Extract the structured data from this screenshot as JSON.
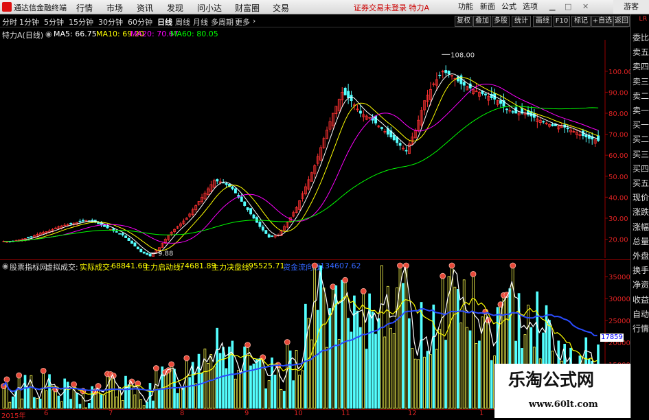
{
  "app": {
    "title": "通达信金融终端",
    "menu": [
      "行情",
      "市场",
      "资讯",
      "发现",
      "问小达",
      "财富圈",
      "交易"
    ],
    "notice": "证券交易未登录 特力A",
    "toolbar": [
      "功能",
      "新面",
      "公式",
      "选项"
    ],
    "guest": "游客"
  },
  "periods": {
    "items": [
      "分时",
      "1分钟",
      "5分钟",
      "15分钟",
      "30分钟",
      "60分钟",
      "日线",
      "周线",
      "月线",
      "多周期",
      "更多"
    ],
    "active": "日线"
  },
  "chart_tools": [
    "复权",
    "叠加",
    "多股",
    "统计",
    "画线",
    "F10",
    "标记",
    "+自选",
    "返回"
  ],
  "sidebar": {
    "items": [
      "委比",
      "卖五",
      "卖四",
      "卖三",
      "卖二",
      "卖一",
      "买一",
      "买二",
      "买三",
      "买四",
      "买五",
      "现价",
      "涨跌",
      "涨幅",
      "总量",
      "外盘",
      "换手",
      "净资",
      "收益",
      "自动",
      "行情"
    ],
    "extra": [
      "L",
      "R"
    ]
  },
  "price_info": {
    "stock": "特力A(日线)",
    "ma5": "MA5: 66.75",
    "ma10": "MA10: 69.20",
    "ma20": "MA20: 70.67",
    "ma60": "MA60: 80.05"
  },
  "vol_info": {
    "indicator": "股票指标网",
    "virtual": "虚拟成交:",
    "real": "实际成交:",
    "real_val": "68841.60",
    "start": "主力启动线:",
    "start_val": "74681.89",
    "decide": "主力决盘线:",
    "decide_val": "95525.71",
    "fund": "资金流向线:",
    "fund_val": "134607.62"
  },
  "annotations": {
    "high": "108.00",
    "low": "9.88"
  },
  "last_vol_label": "17859",
  "date_axis": [
    "2015年",
    "6",
    "7",
    "8",
    "9",
    "10",
    "11",
    "12",
    "1"
  ],
  "watermark": {
    "cn": "乐淘公式网",
    "url": "www.60lt.com"
  },
  "colors": {
    "up": "#ff3232",
    "down": "#54ffff",
    "ma5": "#ffffff",
    "ma10": "#ffff00",
    "ma20": "#ff00ff",
    "ma60": "#00ff00"
  },
  "chart_data": [
    {
      "type": "candlestick",
      "title": "特力A(日线)",
      "yticks": [
        20,
        30,
        40,
        50,
        60,
        70,
        80,
        90,
        100
      ],
      "ylim": [
        12,
        114
      ],
      "series_labels": [
        "MA5",
        "MA10",
        "MA20",
        "MA60"
      ],
      "ma_last": [
        66.75,
        69.2,
        70.67,
        80.05
      ],
      "high_marker": 108.0,
      "low_marker": 9.88,
      "close_path": [
        19,
        19,
        20,
        21,
        23,
        24,
        26,
        27,
        28,
        29,
        28,
        26,
        24,
        22,
        18,
        14,
        12,
        16,
        22,
        26,
        30,
        36,
        42,
        48,
        47,
        44,
        38,
        32,
        26,
        21,
        22,
        28,
        35,
        45,
        55,
        68,
        80,
        90,
        86,
        80,
        78,
        74,
        70,
        66,
        62,
        72,
        86,
        94,
        100,
        98,
        94,
        92,
        90,
        88,
        86,
        82,
        80,
        80,
        78,
        76,
        74,
        74,
        72,
        70,
        68,
        67
      ]
    },
    {
      "type": "bar",
      "title": "股票指标网",
      "yticks": [
        15000,
        20000,
        25000,
        30000,
        35000
      ],
      "ylim": [
        5000,
        37500
      ],
      "last_value": 17859,
      "lines": [
        "实际成交",
        "主力启动线",
        "主力决盘线",
        "资金流向线"
      ],
      "volume_path": [
        7,
        8,
        9,
        10,
        9,
        8,
        7,
        7,
        6,
        6,
        7,
        8,
        9,
        8,
        7,
        7,
        8,
        9,
        10,
        11,
        12,
        14,
        18,
        20,
        19,
        16,
        14,
        12,
        11,
        10,
        11,
        13,
        16,
        22,
        28,
        30,
        26,
        24,
        22,
        20,
        24,
        30,
        34,
        30,
        26,
        22,
        20,
        24,
        28,
        32,
        30,
        26,
        22,
        20,
        22,
        24,
        28,
        30,
        26,
        22,
        18,
        16,
        15,
        14,
        14,
        14
      ]
    }
  ]
}
